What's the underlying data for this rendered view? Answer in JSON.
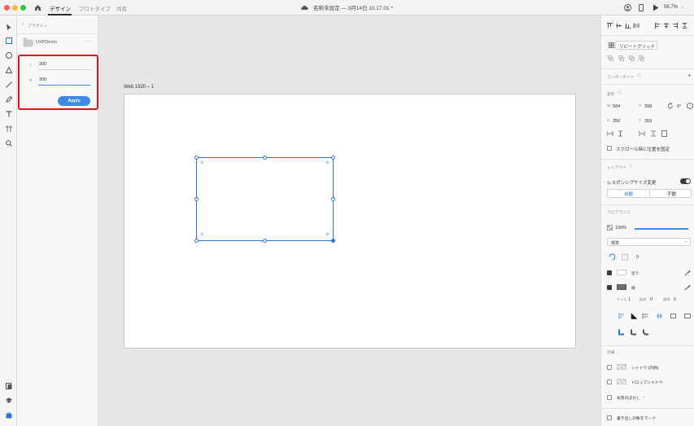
{
  "titlebar": {
    "tabs": [
      "デザイン",
      "プロトタイプ",
      "共有"
    ],
    "doc_title": "名称未設定 — 3月14日 10.17.01 *",
    "zoom": "56.7%"
  },
  "plugin_panel": {
    "back_label": "プラグイン",
    "plugin_name": "UXPDemo",
    "more": "···",
    "field1_label": "I",
    "field1_value": "300",
    "field2_label": "H",
    "field2_value": "300",
    "apply_label": "Apply"
  },
  "canvas": {
    "artboard_name": "Web 1920 – 1"
  },
  "props": {
    "repeat_grid": "リピートグリッド",
    "component_h": "コンポーネント",
    "transform_h": "変形",
    "w_label": "W",
    "w_value": "584",
    "x_label": "X",
    "x_value": "308",
    "rotate_value": "0°",
    "h_label": "H",
    "h_value": "356",
    "y_label": "Y",
    "y_value": "269",
    "scroll_fix": "スクロール時に位置を固定",
    "layout_h": "レイアウト",
    "responsive": "レスポンシブサイズ変更",
    "auto": "自動",
    "manual": "手動",
    "appearance_h": "アピアランス",
    "opacity": "100%",
    "blend": "標準",
    "corner_value": "0",
    "fill_label": "塗り",
    "border_label": "線",
    "size_label": "サイズ",
    "size_value": "1",
    "dash_label": "破線",
    "dash_value": "0",
    "gap_label": "間隔",
    "gap_value": "0",
    "effects_h": "効果",
    "inner_shadow": "シャドウ (内側)",
    "drop_shadow": "ドロップシャドウ",
    "bg_blur": "背景のぼかし",
    "export_batch": "書き出し対象をマーク"
  },
  "colors": {
    "accent": "#3f8be3",
    "selection": "#2c74d6",
    "highlight": "#e0111a"
  }
}
